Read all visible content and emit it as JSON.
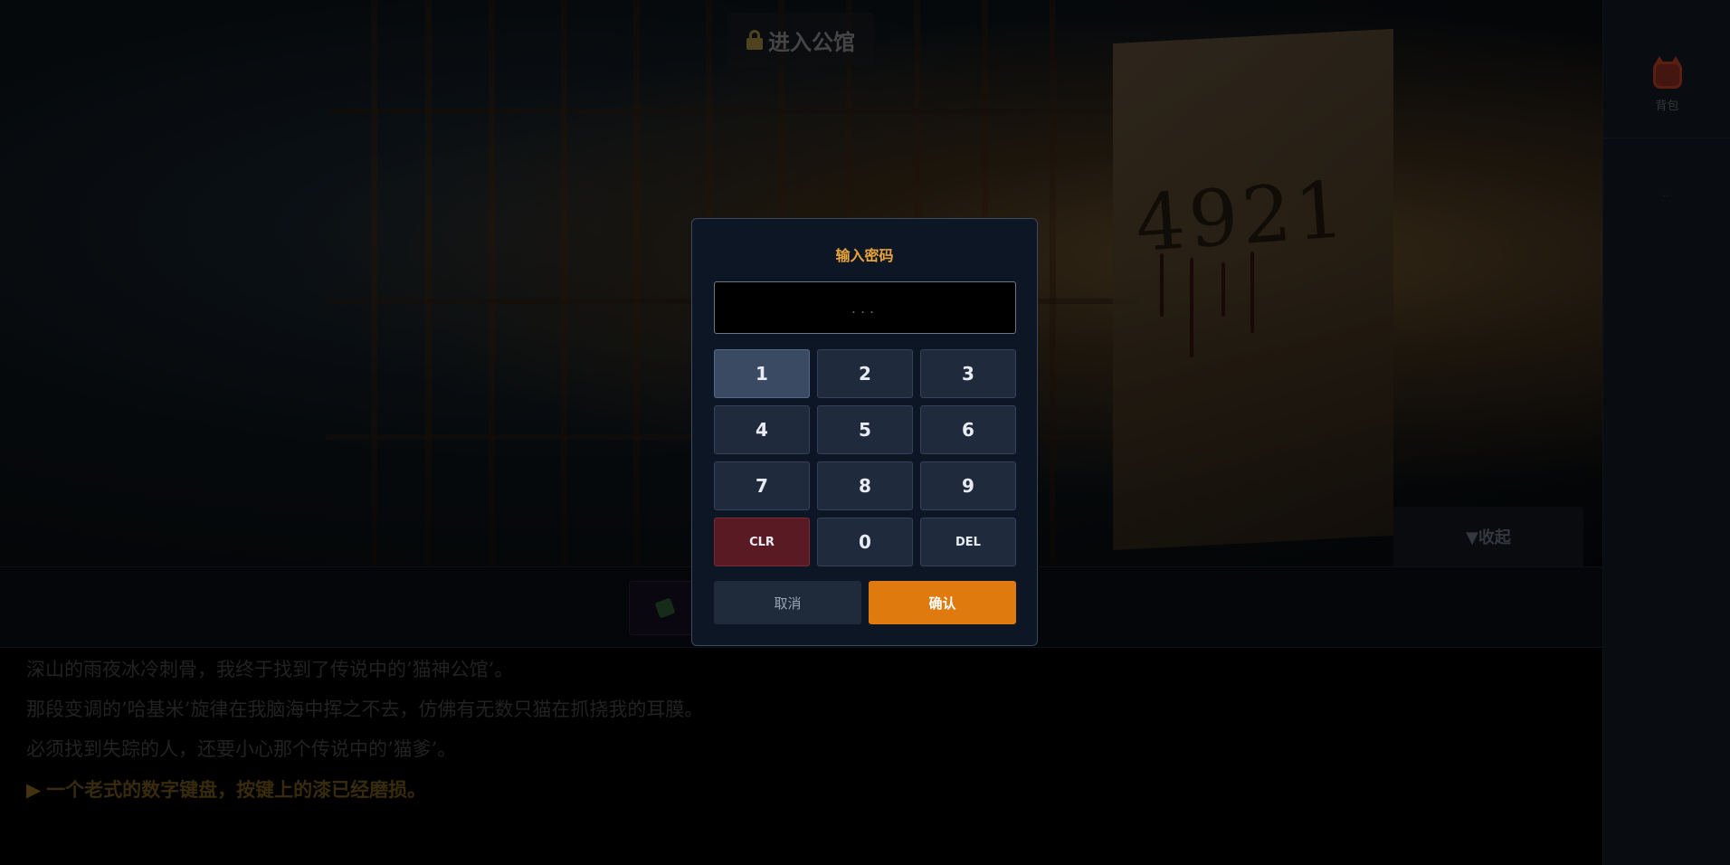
{
  "scene": {
    "location_label": "进入公馆",
    "door_number": "4921"
  },
  "side_panel": {
    "backpack_label": "背包",
    "small_text": "··"
  },
  "action_bar": {
    "collapse_label": "▼收起"
  },
  "story": {
    "lines": [
      "深山的雨夜冰冷刺骨，我终于找到了传说中的’猫神公馆’。",
      "那段变调的’哈基米’旋律在我脑海中挥之不去，仿佛有无数只猫在抓挠我的耳膜。",
      "必须找到失踪的人，还要小心那个传说中的’猫爹’。"
    ],
    "choice_arrow": "▶",
    "choice": "一个老式的数字键盘，按键上的漆已经磨损。"
  },
  "keypad": {
    "title": "输入密码",
    "display_placeholder": "...",
    "keys": [
      "1",
      "2",
      "3",
      "4",
      "5",
      "6",
      "7",
      "8",
      "9",
      "CLR",
      "0",
      "DEL"
    ],
    "cancel_label": "取消",
    "confirm_label": "确认",
    "highlighted_key": "1"
  },
  "colors": {
    "accent": "#de7a0e",
    "title": "#e8a33a",
    "clear_key": "#5a1a24",
    "modal_bg": "#0d1625"
  }
}
